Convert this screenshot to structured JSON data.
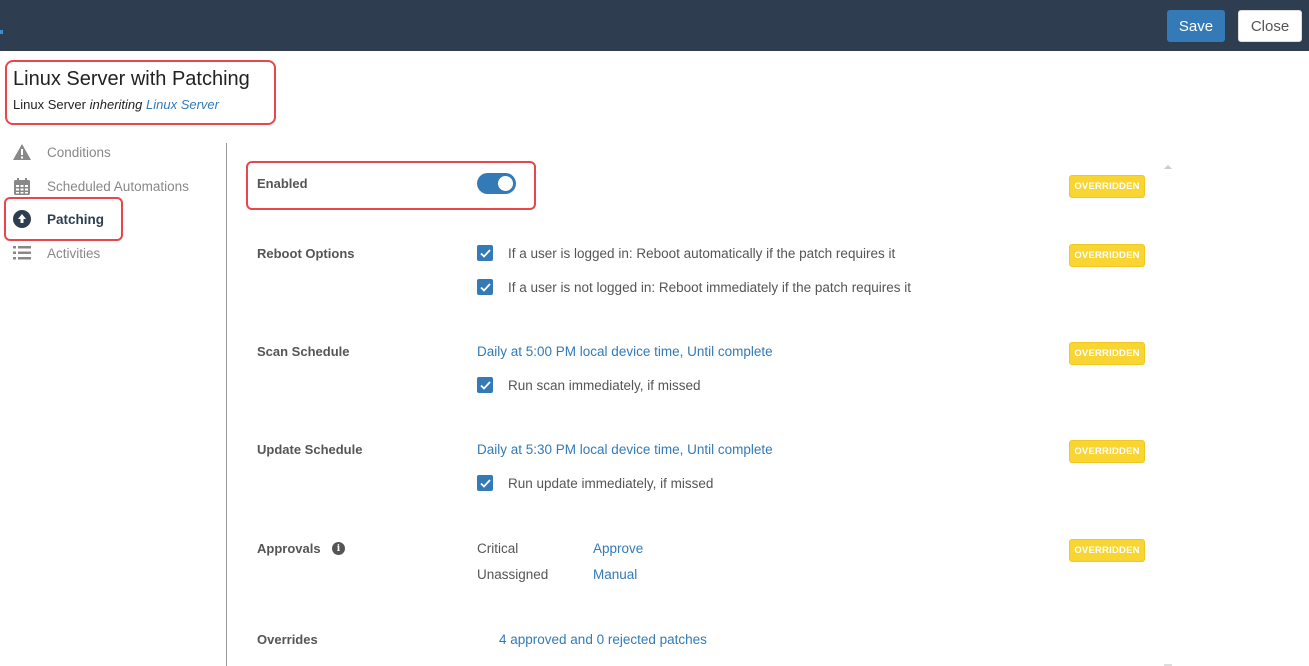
{
  "header": {
    "save_label": "Save",
    "close_label": "Close"
  },
  "policy": {
    "title": "Linux Server with Patching",
    "subtitle_prefix": "Linux Server",
    "subtitle_middle": "inheriting",
    "subtitle_link": "Linux Server"
  },
  "sidebar": {
    "items": [
      {
        "label": "Conditions",
        "icon": "warning-icon",
        "active": false
      },
      {
        "label": "Scheduled Automations",
        "icon": "calendar-icon",
        "active": false
      },
      {
        "label": "Patching",
        "icon": "arrow-up-circle-icon",
        "active": true
      },
      {
        "label": "Activities",
        "icon": "list-icon",
        "active": false
      }
    ]
  },
  "patching": {
    "enabled": {
      "label": "Enabled",
      "value": true,
      "badge": "OVERRIDDEN"
    },
    "reboot": {
      "label": "Reboot Options",
      "badge": "OVERRIDDEN",
      "options": [
        {
          "text": "If a user is logged in: Reboot automatically if the patch requires it",
          "checked": true
        },
        {
          "text": "If a user is not logged in: Reboot immediately if the patch requires it",
          "checked": true
        }
      ]
    },
    "scan": {
      "label": "Scan Schedule",
      "badge": "OVERRIDDEN",
      "schedule_link": "Daily at 5:00 PM local device time",
      "until_link": "Until complete",
      "separator": ", ",
      "missed": {
        "text": "Run scan immediately, if missed",
        "checked": true
      }
    },
    "update": {
      "label": "Update Schedule",
      "badge": "OVERRIDDEN",
      "schedule_link": "Daily at 5:30 PM local device time",
      "until_link": "Until complete",
      "separator": ", ",
      "missed": {
        "text": "Run update immediately, if missed",
        "checked": true
      }
    },
    "approvals": {
      "label": "Approvals",
      "badge": "OVERRIDDEN",
      "info_icon": "i",
      "rows": [
        {
          "category": "Critical",
          "value": "Approve"
        },
        {
          "category": "Unassigned",
          "value": "Manual"
        }
      ]
    },
    "overrides": {
      "label": "Overrides",
      "link": "4 approved and 0 rejected patches"
    }
  }
}
